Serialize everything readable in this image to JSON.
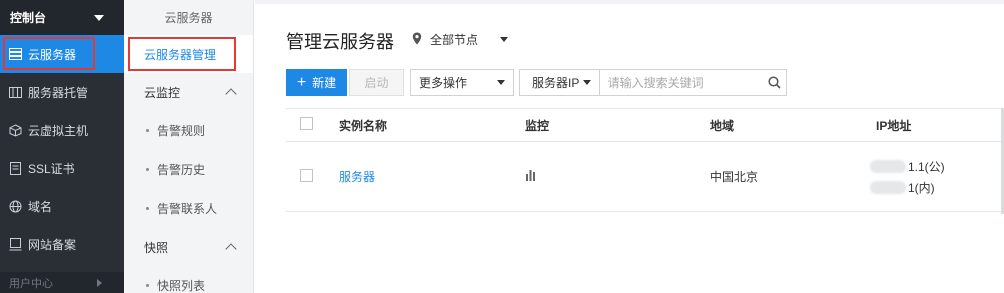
{
  "sidebar": {
    "header": "控制台",
    "items": [
      {
        "label": "云服务器",
        "icon": "server-list-icon",
        "active": true
      },
      {
        "label": "服务器托管",
        "icon": "hosting-icon"
      },
      {
        "label": "云虚拟主机",
        "icon": "cube-icon"
      },
      {
        "label": "SSL证书",
        "icon": "certificate-icon"
      },
      {
        "label": "域名",
        "icon": "globe-icon"
      },
      {
        "label": "网站备案",
        "icon": "record-icon"
      }
    ],
    "bottom": "用户中心"
  },
  "subnav": {
    "title": "云服务器",
    "active_item": "云服务器管理",
    "groups": [
      {
        "label": "云监控",
        "children": [
          "告警规则",
          "告警历史",
          "告警联系人"
        ]
      },
      {
        "label": "快照",
        "children": [
          "快照列表"
        ]
      }
    ]
  },
  "main": {
    "title": "管理云服务器",
    "region": "全部节点",
    "toolbar": {
      "new_label": "新建",
      "start_label": "启动",
      "more_label": "更多操作",
      "filter_type": "服务器IP",
      "search_placeholder": "请输入搜索关键词"
    },
    "table": {
      "headers": [
        "实例名称",
        "监控",
        "地域",
        "IP地址"
      ],
      "rows": [
        {
          "name": "服务器",
          "monitor_icon": "bar-chart-icon",
          "region": "中国北京",
          "ip_public": "1.1(公)",
          "ip_private": "1(内)"
        }
      ]
    }
  },
  "colors": {
    "accent": "#1e88e5",
    "sidebar_bg": "#2a2f36",
    "highlight": "#e53935"
  }
}
